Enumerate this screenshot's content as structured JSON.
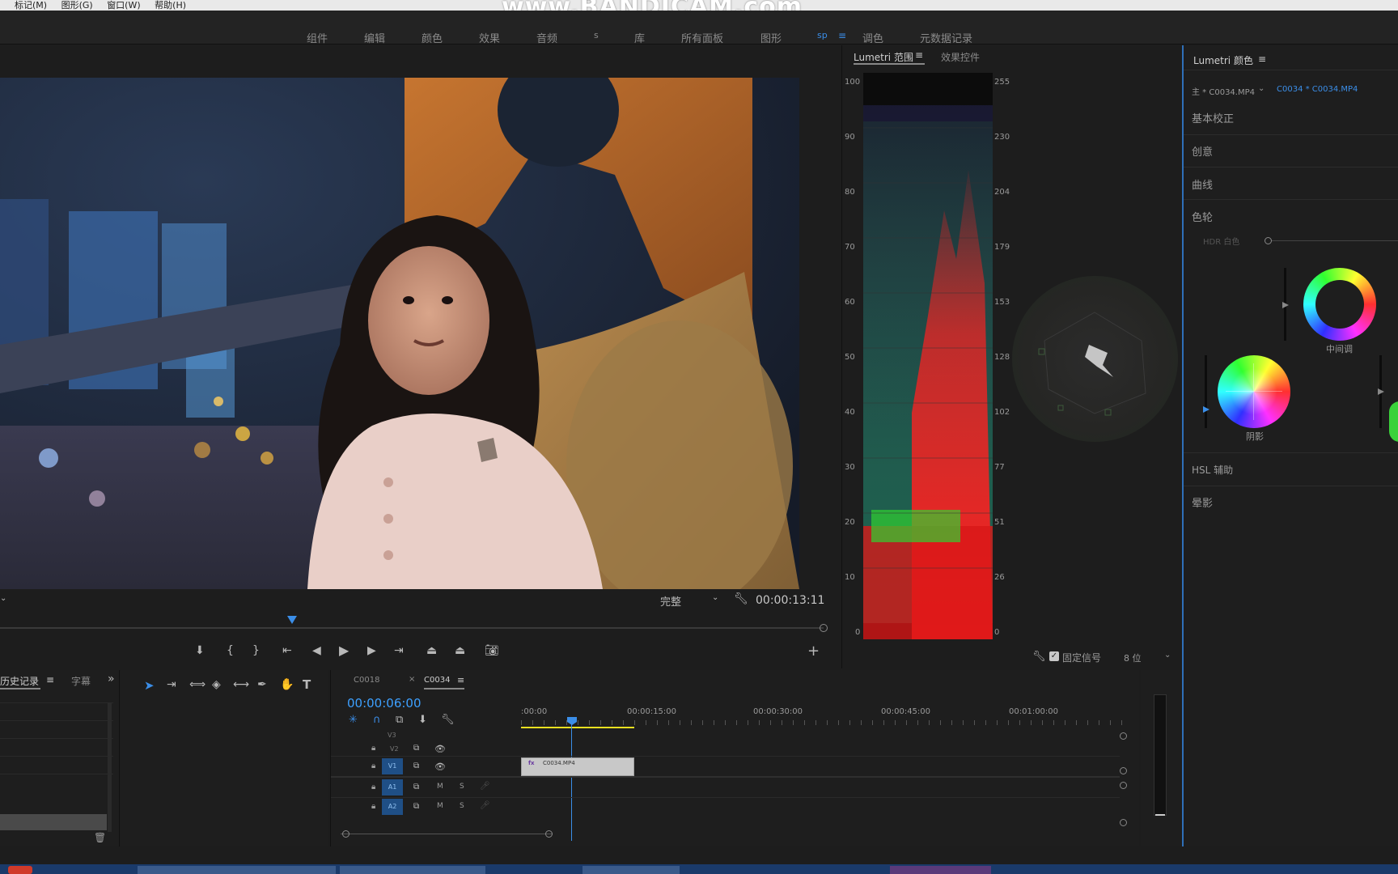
{
  "menu": {
    "items": [
      "标记(M)",
      "图形(G)",
      "窗口(W)",
      "帮助(H)"
    ],
    "watermark": "www.BANDICAM.com"
  },
  "workspaces": {
    "tabs": [
      "组件",
      "编辑",
      "颜色",
      "效果",
      "音频",
      "s",
      "库",
      "所有面板",
      "图形",
      "sp",
      "调色",
      "元数据记录"
    ],
    "active": "sp"
  },
  "program_monitor": {
    "fit_label": "完整",
    "timecode": "00:00:13:11"
  },
  "scopes": {
    "tabs": {
      "lumetri_scopes": "Lumetri 范围",
      "effect_controls": "效果控件"
    },
    "left_axis": [
      "100",
      "90",
      "80",
      "70",
      "60",
      "50",
      "40",
      "30",
      "20",
      "10",
      "0"
    ],
    "right_axis": [
      "255",
      "230",
      "204",
      "179",
      "153",
      "128",
      "102",
      "77",
      "51",
      "26",
      "0"
    ],
    "clamp_label": "固定信号",
    "bit_depth": "8 位"
  },
  "lumetri": {
    "title": "Lumetri 颜色",
    "master_clip": "主 * C0034.MP4",
    "sequence_clip": "C0034 * C0034.MP4",
    "sections": {
      "basic": "基本校正",
      "creative": "创意",
      "curves": "曲线",
      "wheels": "色轮",
      "hsl": "HSL 辅助",
      "vignette": "晕影"
    },
    "hdr_label": "HDR 白色",
    "midtones": "中间调",
    "shadows": "阴影"
  },
  "history": {
    "tab": "历史记录",
    "tab2": "字幕"
  },
  "timeline": {
    "tabs": {
      "seq1": "C0018",
      "seq2": "C0034"
    },
    "current_time": "00:00:06:00",
    "ruler": [
      ":00:00",
      "00:00:15:00",
      "00:00:30:00",
      "00:00:45:00",
      "00:01:00:00"
    ],
    "tracks": {
      "v3": "V3",
      "v2": "V2",
      "v1": "V1",
      "a1": "A1",
      "a2": "A2",
      "m": "M",
      "s": "S"
    },
    "clip_name": "C0034.MP4"
  },
  "colors": {
    "accent": "#3b8ee8",
    "timecode_blue": "#3da0ff",
    "panel_bg": "#1e1e1e",
    "clip": "#c8c8c8"
  }
}
